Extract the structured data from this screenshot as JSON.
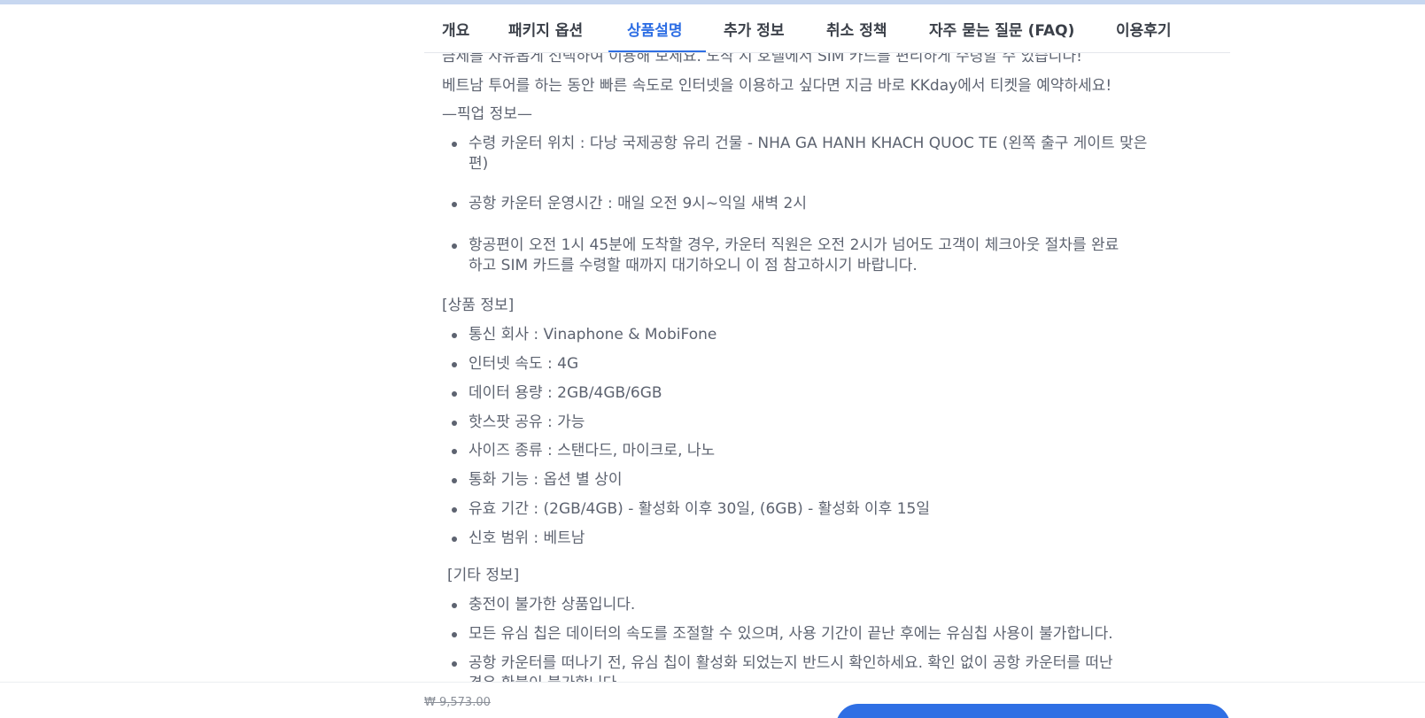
{
  "tabs": [
    {
      "label": "개요"
    },
    {
      "label": "패키지 옵션"
    },
    {
      "label": "상품설명"
    },
    {
      "label": "추가 정보"
    },
    {
      "label": "취소 정책"
    },
    {
      "label": "자주 묻는 질문 (FAQ)"
    },
    {
      "label": "이용후기"
    }
  ],
  "active_tab": "상품설명",
  "intro": {
    "partial_line": "금제를 자유롭게 선택하여 이용해 보세요. 도착 시 호텔에서 SIM 카드를 편리하게 수령할 수 있습니다!",
    "line2": "베트남 투어를 하는 동안 빠른 속도로 인터넷을 이용하고 싶다면 지금 바로 KKday에서 티켓을 예약하세요!",
    "pickup_heading": "—픽업 정보—"
  },
  "pickup": {
    "items": [
      {
        "line1": "수령 카운터 위치 : 다낭 국제공항 유리 건물 - NHA GA HANH KHACH QUOC TE (왼쪽 출구 게이트 맞은",
        "line2": "편)"
      },
      {
        "line1": "공항 카운터 운영시간 : 매일 오전 9시~익일 새벽 2시"
      },
      {
        "line1": "항공편이 오전 1시 45분에 도착할 경우, 카운터 직원은 오전 2시가 넘어도 고객이 체크아웃 절차를 완료",
        "line2": "하고 SIM 카드를 수령할 때까지 대기하오니 이 점 참고하시기 바랍니다."
      }
    ]
  },
  "product_info": {
    "heading": "[상품 정보]",
    "items": [
      "통신 회사 : Vinaphone & MobiFone",
      "인터넷 속도 : 4G",
      "데이터 용량 : 2GB/4GB/6GB",
      "핫스팟 공유 : 가능",
      "사이즈 종류 : 스탠다드, 마이크로, 나노",
      "통화 기능 : 옵션 별 상이",
      "유효 기간 : (2GB/4GB) - 활성화 이후 30일, (6GB) - 활성화 이후 15일",
      "신호 범위 : 베트남"
    ]
  },
  "other_info": {
    "heading": "[기타 정보]",
    "items": [
      {
        "line1": "충전이 불가한 상품입니다."
      },
      {
        "line1": "모든 유심 칩은 데이터의 속도를 조절할 수 있으며, 사용 기간이 끝난 후에는 유심칩 사용이 불가합니다."
      },
      {
        "line1": "공항 카운터를 떠나기 전, 유심 칩이 활성화 되었는지 반드시 확인하세요. 확인 없이 공항 카운터를 떠난",
        "line2": "경우 환불이 불가합니다."
      }
    ]
  },
  "bottom_bar": {
    "old_price": "₩ 9,573.00"
  },
  "colors": {
    "accent": "#2f6fe4",
    "text": "#5d6370",
    "tab_text": "#3b4049"
  }
}
